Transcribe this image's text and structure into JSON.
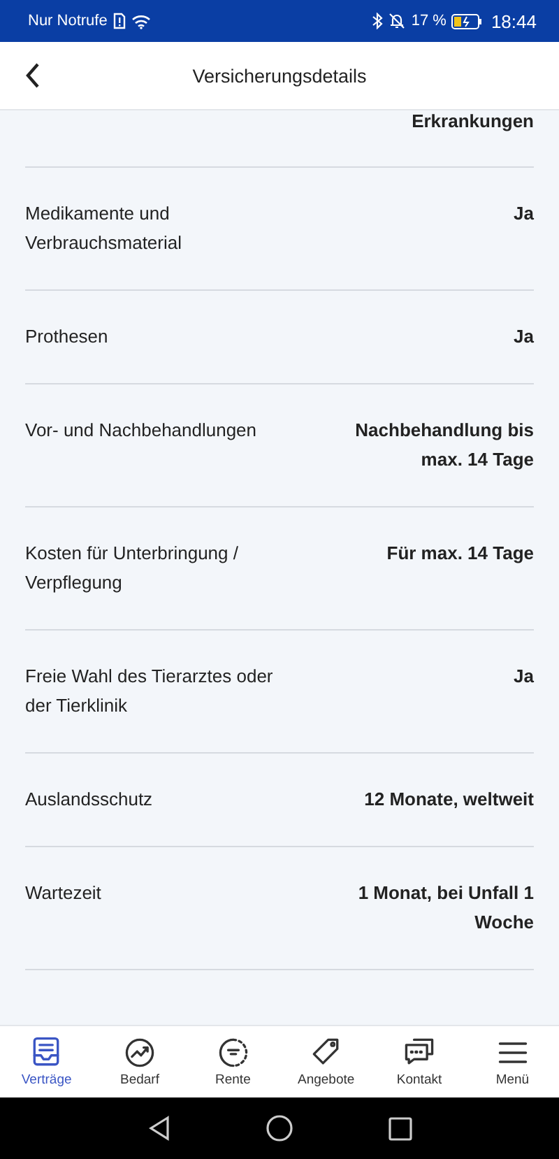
{
  "status_bar": {
    "carrier": "Nur Notrufe",
    "battery": "17 %",
    "time": "18:44"
  },
  "header": {
    "title": "Versicherungsdetails"
  },
  "rows": [
    {
      "value": "Erkrankungen"
    },
    {
      "label": "Medikamente und Verbrauchsmaterial",
      "value": "Ja"
    },
    {
      "label": "Prothesen",
      "value": "Ja"
    },
    {
      "label": "Vor- und Nachbehandlungen",
      "value": "Nachbehandlung bis max. 14 Tage"
    },
    {
      "label": "Kosten für Unterbringung / Verpflegung",
      "value": "Für max. 14 Tage"
    },
    {
      "label": "Freie Wahl des Tierarztes oder der Tierklinik",
      "value": "Ja"
    },
    {
      "label": "Auslandsschutz",
      "value": "12 Monate, weltweit"
    },
    {
      "label": "Wartezeit",
      "value": "1 Monat, bei Unfall 1 Woche"
    }
  ],
  "tab_bar": [
    {
      "label": "Verträge",
      "kind": "contracts",
      "selected": true
    },
    {
      "label": "Bedarf",
      "kind": "chart",
      "selected": false
    },
    {
      "label": "Rente",
      "kind": "pension",
      "selected": false
    },
    {
      "label": "Angebote",
      "kind": "tag",
      "selected": false
    },
    {
      "label": "Kontakt",
      "kind": "chat",
      "selected": false
    },
    {
      "label": "Menü",
      "kind": "menu",
      "selected": false
    }
  ]
}
